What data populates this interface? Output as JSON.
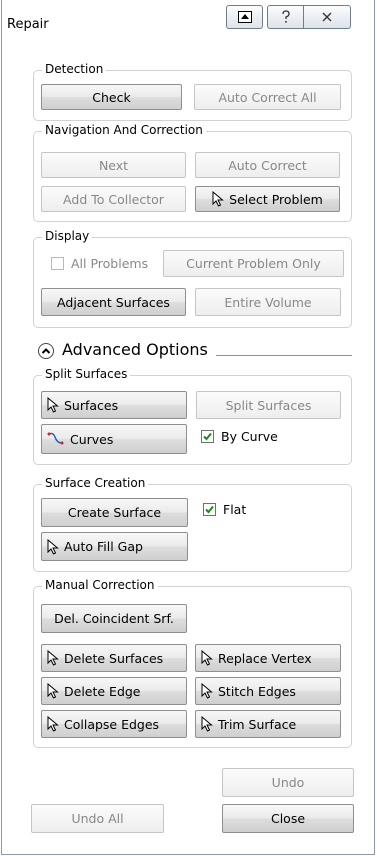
{
  "window": {
    "title": "Repair"
  },
  "detection": {
    "legend": "Detection",
    "check": "Check",
    "auto_correct_all": "Auto Correct All"
  },
  "navigation": {
    "legend": "Navigation And Correction",
    "next": "Next",
    "auto_correct": "Auto Correct",
    "add_to_collector": "Add To Collector",
    "select_problem": "Select Problem"
  },
  "display": {
    "legend": "Display",
    "all_problems": "All Problems",
    "current_problem_only": "Current Problem Only",
    "adjacent_surfaces": "Adjacent Surfaces",
    "entire_volume": "Entire Volume"
  },
  "advanced": {
    "label": "Advanced Options"
  },
  "split": {
    "legend": "Split Surfaces",
    "surfaces": "Surfaces",
    "split_surfaces": "Split Surfaces",
    "curves": "Curves",
    "by_curve": "By Curve"
  },
  "creation": {
    "legend": "Surface Creation",
    "create_surface": "Create Surface",
    "flat": "Flat",
    "auto_fill_gap": "Auto Fill Gap"
  },
  "manual": {
    "legend": "Manual Correction",
    "del_coincident": "Del. Coincident Srf.",
    "delete_surfaces": "Delete Surfaces",
    "replace_vertex": "Replace Vertex",
    "delete_edge": "Delete Edge",
    "stitch_edges": "Stitch Edges",
    "collapse_edges": "Collapse Edges",
    "trim_surface": "Trim Surface"
  },
  "footer": {
    "undo": "Undo",
    "undo_all": "Undo All",
    "close": "Close"
  },
  "icons": {
    "cursor": "pointer-cursor-icon",
    "curves": "curves-icon",
    "restore": "restore-icon",
    "help": "help-icon",
    "close": "close-icon",
    "advanced_toggle": "chevron-up-icon"
  },
  "colors": {
    "check_green": "#1a8a1a",
    "disabled_text": "#888888"
  }
}
